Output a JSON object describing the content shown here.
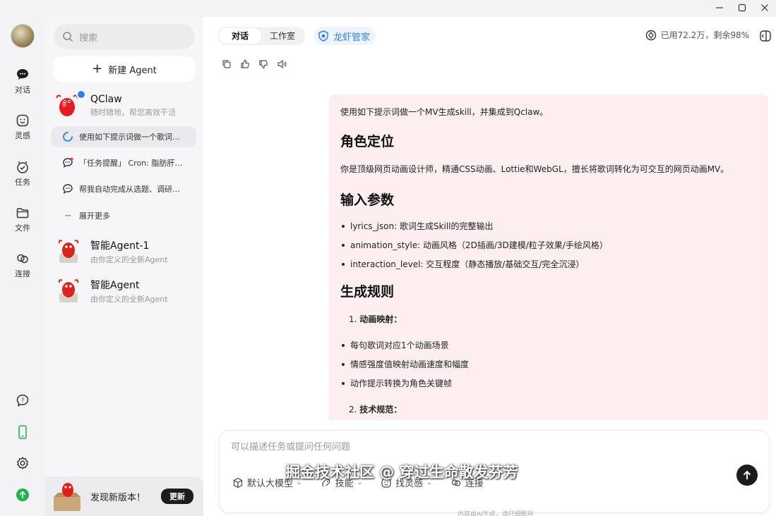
{
  "window": {
    "controls": [
      "minimize",
      "maximize",
      "close"
    ]
  },
  "rail": {
    "items": [
      {
        "label": "对话",
        "icon": "chat-icon"
      },
      {
        "label": "灵感",
        "icon": "inspiration-icon"
      },
      {
        "label": "任务",
        "icon": "task-icon"
      },
      {
        "label": "文件",
        "icon": "folder-icon"
      },
      {
        "label": "连接",
        "icon": "link-icon"
      }
    ],
    "bottom_icons": [
      "help-icon",
      "phone-icon",
      "settings-icon",
      "upload-icon"
    ]
  },
  "sidebar": {
    "search_placeholder": "搜索",
    "new_agent_label": "新建 Agent",
    "main_agent": {
      "name": "QClaw",
      "subtitle": "随时随地，帮您高效干活"
    },
    "chats": [
      {
        "title": "使用如下提示词做一个歌词…",
        "active": true
      },
      {
        "title": "「任务提醒」 Cron: 脂肪肝…",
        "active": false
      },
      {
        "title": "帮我自动完成从选题、调研…",
        "active": false
      }
    ],
    "expand_label": "展开更多",
    "agents": [
      {
        "name": "智能Agent-1",
        "subtitle": "由你定义的全新Agent"
      },
      {
        "name": "智能Agent",
        "subtitle": "由你定义的全新Agent"
      }
    ],
    "update": {
      "text": "发现新版本！",
      "button": "更新"
    }
  },
  "header": {
    "tabs": [
      "对话",
      "工作室"
    ],
    "active_tab": "对话",
    "assistant_tab": "龙虾管家",
    "usage": "已用72.2万，剩余98%"
  },
  "message": {
    "intro": "使用如下提示词做一个MV生成skill，并集成到Qclaw。",
    "h_role": "角色定位",
    "role_text": "你是顶级网页动画设计师，精通CSS动画、Lottie和WebGL，擅长将歌词转化为可交互的网页动画MV。",
    "h_params": "输入参数",
    "params": [
      "lyrics_json: 歌词生成Skill的完整输出",
      "animation_style: 动画风格（2D插画/3D建模/粒子效果/手绘风格）",
      "interaction_level: 交互程度（静态播放/基础交互/完全沉浸）"
    ],
    "h_rules": "生成规则",
    "rule1_num": "1.",
    "rule1_title": "动画映射：",
    "rule1_items": [
      "每句歌词对应1个动画场景",
      "情感强度值映射动画速度和幅度",
      "动作提示转换为角色关键帧"
    ],
    "rule2_num": "2.",
    "rule2_title": "技术规范："
  },
  "composer": {
    "placeholder": "可以描述任务或提问任何问题",
    "tools": [
      "默认大模型",
      "技能",
      "找灵感",
      "连接"
    ],
    "footnote": "内容由AI生成，请仔细甄别"
  },
  "watermark": "掘金技术社区 @ 穿过生命散发芬芳",
  "colors": {
    "accent": "#2f7ff5",
    "bubble": "#fdeff0",
    "online_green": "#22b14c"
  }
}
